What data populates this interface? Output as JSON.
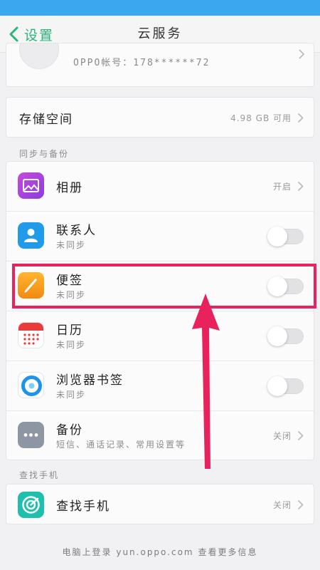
{
  "nav": {
    "back_label": "设置",
    "title": "云服务"
  },
  "account": {
    "text": "OPPO帐号：178******72"
  },
  "storage": {
    "title": "存储空间",
    "value": "4.98 GB 可用"
  },
  "sections": {
    "sync": "同步与备份",
    "find": "查找手机"
  },
  "sync_items": [
    {
      "title": "相册",
      "subtitle": "",
      "right_text": "开启",
      "control": "chevron",
      "icon": "photo-album-icon"
    },
    {
      "title": "联系人",
      "subtitle": "未同步",
      "control": "toggle",
      "toggle_on": false,
      "icon": "contacts-icon"
    },
    {
      "title": "便签",
      "subtitle": "未同步",
      "control": "toggle",
      "toggle_on": false,
      "icon": "notes-icon"
    },
    {
      "title": "日历",
      "subtitle": "未同步",
      "control": "toggle",
      "toggle_on": false,
      "icon": "calendar-icon"
    },
    {
      "title": "浏览器书签",
      "subtitle": "未同步",
      "control": "toggle",
      "toggle_on": false,
      "icon": "browser-icon"
    },
    {
      "title": "备份",
      "subtitle": "短信、通话记录、常用设置等",
      "right_text": "关闭",
      "control": "chevron",
      "icon": "backup-icon"
    }
  ],
  "find_phone": {
    "title": "查找手机",
    "right_text": "关闭",
    "icon": "find-phone-icon"
  },
  "footer": "电脑上登录 yun.oppo.com 查看更多信息",
  "colors": {
    "status_bar": "#3aa7ee",
    "accent_green": "#2bb47a",
    "highlight": "#e8225c"
  }
}
